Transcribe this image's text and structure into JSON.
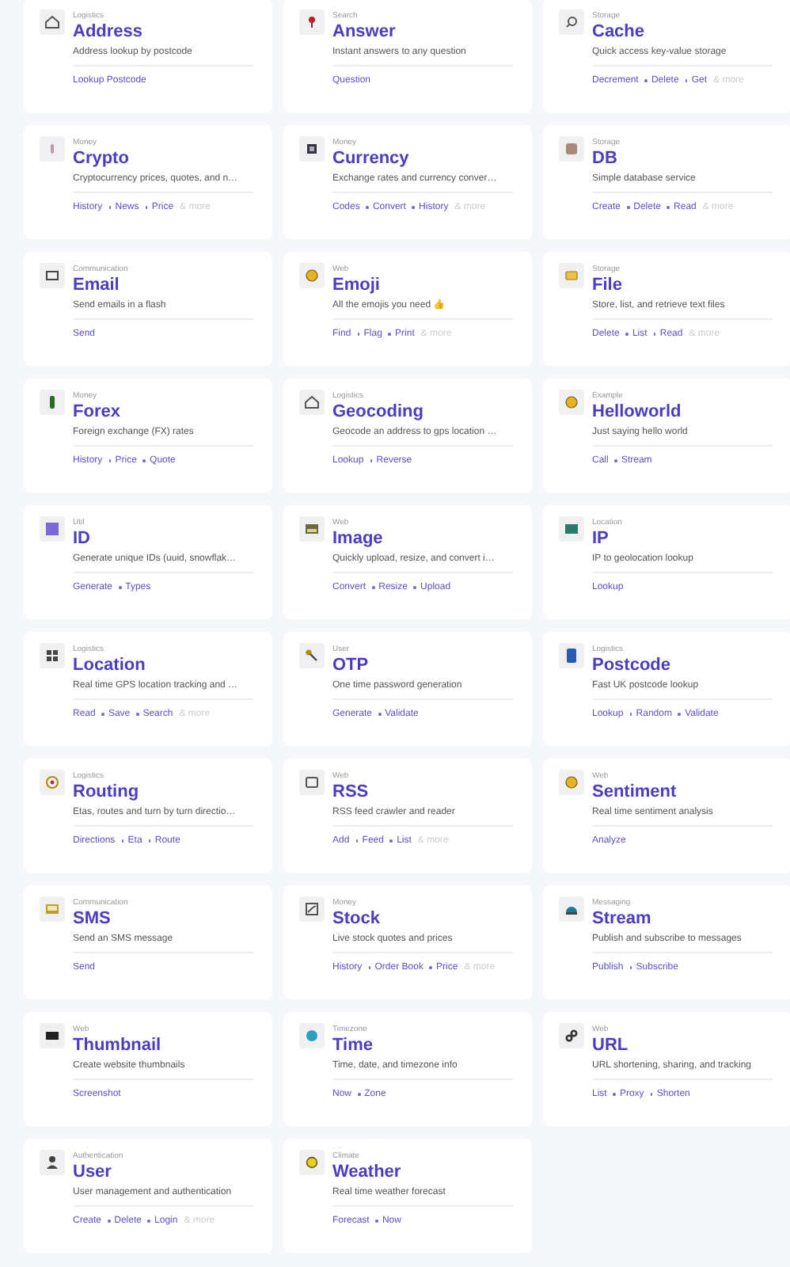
{
  "services": [
    {
      "category": "Logistics",
      "name": "Address",
      "description": "Address lookup by postcode",
      "methods": [
        "Lookup Postcode"
      ]
    },
    {
      "category": "Search",
      "name": "Answer",
      "description": "Instant answers to any question",
      "methods": [
        "Question"
      ]
    },
    {
      "category": "Storage",
      "name": "Cache",
      "description": "Quick access key-value storage",
      "methods": [
        "Decrement",
        "Delete",
        "Get"
      ],
      "more": "& more"
    },
    {
      "category": "Money",
      "name": "Crypto",
      "description": "Cryptocurrency prices, quotes, and n…",
      "methods": [
        "History",
        "News",
        "Price"
      ],
      "more": "& more"
    },
    {
      "category": "Money",
      "name": "Currency",
      "description": "Exchange rates and currency conver…",
      "methods": [
        "Codes",
        "Convert",
        "History"
      ],
      "more": "& more"
    },
    {
      "category": "Storage",
      "name": "DB",
      "description": "Simple database service",
      "methods": [
        "Create",
        "Delete",
        "Read"
      ],
      "more": "& more"
    },
    {
      "category": "Communication",
      "name": "Email",
      "description": "Send emails in a flash",
      "methods": [
        "Send"
      ]
    },
    {
      "category": "Web",
      "name": "Emoji",
      "description": "All the emojis you need 👍",
      "methods": [
        "Find",
        "Flag",
        "Print"
      ],
      "more": "& more"
    },
    {
      "category": "Storage",
      "name": "File",
      "description": "Store, list, and retrieve text files",
      "methods": [
        "Delete",
        "List",
        "Read"
      ],
      "more": "& more"
    },
    {
      "category": "Money",
      "name": "Forex",
      "description": "Foreign exchange (FX) rates",
      "methods": [
        "History",
        "Price",
        "Quote"
      ]
    },
    {
      "category": "Logistics",
      "name": "Geocoding",
      "description": "Geocode an address to gps location …",
      "methods": [
        "Lookup",
        "Reverse"
      ]
    },
    {
      "category": "Example",
      "name": "Helloworld",
      "description": "Just saying hello world",
      "methods": [
        "Call",
        "Stream"
      ]
    },
    {
      "category": "Util",
      "name": "ID",
      "description": "Generate unique IDs (uuid, snowflak…",
      "methods": [
        "Generate",
        "Types"
      ]
    },
    {
      "category": "Web",
      "name": "Image",
      "description": "Quickly upload, resize, and convert i…",
      "methods": [
        "Convert",
        "Resize",
        "Upload"
      ]
    },
    {
      "category": "Location",
      "name": "IP",
      "description": "IP to geolocation lookup",
      "methods": [
        "Lookup"
      ]
    },
    {
      "category": "Logistics",
      "name": "Location",
      "description": "Real time GPS location tracking and …",
      "methods": [
        "Read",
        "Save",
        "Search"
      ],
      "more": "& more"
    },
    {
      "category": "User",
      "name": "OTP",
      "description": "One time password generation",
      "methods": [
        "Generate",
        "Validate"
      ]
    },
    {
      "category": "Logistics",
      "name": "Postcode",
      "description": "Fast UK postcode lookup",
      "methods": [
        "Lookup",
        "Random",
        "Validate"
      ]
    },
    {
      "category": "Logistics",
      "name": "Routing",
      "description": "Etas, routes and turn by turn directio…",
      "methods": [
        "Directions",
        "Eta",
        "Route"
      ]
    },
    {
      "category": "Web",
      "name": "RSS",
      "description": "RSS feed crawler and reader",
      "methods": [
        "Add",
        "Feed",
        "List"
      ],
      "more": "& more"
    },
    {
      "category": "Web",
      "name": "Sentiment",
      "description": "Real time sentiment analysis",
      "methods": [
        "Analyze"
      ]
    },
    {
      "category": "Communication",
      "name": "SMS",
      "description": "Send an SMS message",
      "methods": [
        "Send"
      ]
    },
    {
      "category": "Money",
      "name": "Stock",
      "description": "Live stock quotes and prices",
      "methods": [
        "History",
        "Order Book",
        "Price"
      ],
      "more": "& more"
    },
    {
      "category": "Messaging",
      "name": "Stream",
      "description": "Publish and subscribe to messages",
      "methods": [
        "Publish",
        "Subscribe"
      ]
    },
    {
      "category": "Web",
      "name": "Thumbnail",
      "description": "Create website thumbnails",
      "methods": [
        "Screenshot"
      ]
    },
    {
      "category": "Timezone",
      "name": "Time",
      "description": "Time, date, and timezone info",
      "methods": [
        "Now",
        "Zone"
      ]
    },
    {
      "category": "Web",
      "name": "URL",
      "description": "URL shortening, sharing, and tracking",
      "methods": [
        "List",
        "Proxy",
        "Shorten"
      ]
    },
    {
      "category": "Authentication",
      "name": "User",
      "description": "User management and authentication",
      "methods": [
        "Create",
        "Delete",
        "Login"
      ],
      "more": "& more"
    },
    {
      "category": "Climate",
      "name": "Weather",
      "description": "Real time weather forecast",
      "methods": [
        "Forecast",
        "Now"
      ]
    }
  ]
}
